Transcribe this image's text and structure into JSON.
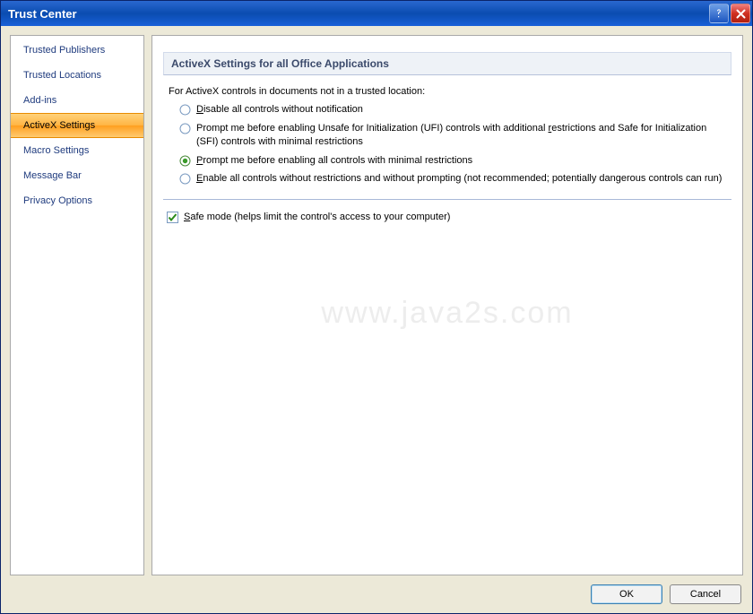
{
  "title": "Trust Center",
  "sidebar": {
    "items": [
      {
        "label": "Trusted Publishers",
        "selected": false
      },
      {
        "label": "Trusted Locations",
        "selected": false
      },
      {
        "label": "Add-ins",
        "selected": false
      },
      {
        "label": "ActiveX Settings",
        "selected": true
      },
      {
        "label": "Macro Settings",
        "selected": false
      },
      {
        "label": "Message Bar",
        "selected": false
      },
      {
        "label": "Privacy Options",
        "selected": false
      }
    ]
  },
  "section_header": "ActiveX Settings for all Office Applications",
  "intro": "For ActiveX controls in documents not in a trusted location:",
  "radios": [
    {
      "pre": "",
      "u": "D",
      "post": "isable all controls without notification",
      "checked": false
    },
    {
      "pre": "Prompt me before enabling Unsafe for Initialization (UFI) controls with additional ",
      "u": "r",
      "post": "estrictions and Safe for Initialization (SFI) controls with minimal restrictions",
      "checked": false
    },
    {
      "pre": "",
      "u": "P",
      "post": "rompt me before enabling all controls with minimal restrictions",
      "checked": true
    },
    {
      "pre": "",
      "u": "E",
      "post": "nable all controls without restrictions and without prompting (not recommended; potentially dangerous controls can run)",
      "checked": false
    }
  ],
  "checkbox": {
    "pre": "",
    "u": "S",
    "post": "afe mode (helps limit the control's access to your computer)",
    "checked": true
  },
  "buttons": {
    "ok": "OK",
    "cancel": "Cancel"
  },
  "watermark": "www.java2s.com"
}
